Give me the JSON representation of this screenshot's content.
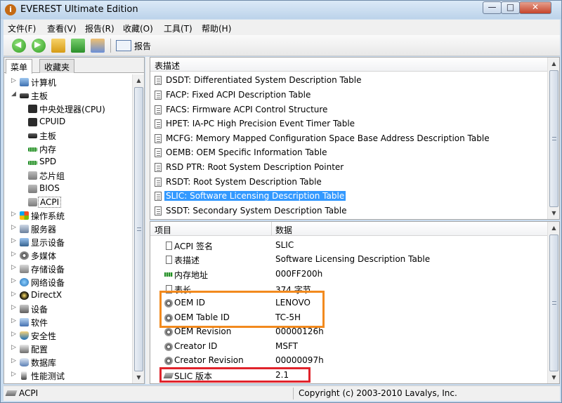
{
  "window": {
    "title": "EVEREST Ultimate Edition",
    "app_icon_glyph": "i"
  },
  "window_controls": {
    "minimize": "—",
    "maximize": "□",
    "close": "✕"
  },
  "menu": [
    "文件(F)",
    "查看(V)",
    "报告(R)",
    "收藏(O)",
    "工具(T)",
    "帮助(H)"
  ],
  "toolbar": {
    "report_label": "报告",
    "back_glyph": "◀",
    "forward_glyph": "▶"
  },
  "left_tabs": {
    "menu": "菜单",
    "favorites": "收藏夹"
  },
  "tree": [
    {
      "label": "计算机",
      "expander": "▷",
      "icon": "computer-icon"
    },
    {
      "label": "主板",
      "expander": "◢",
      "icon": "motherboard-icon"
    },
    {
      "label": "中央处理器(CPU)",
      "icon": "cpu-icon"
    },
    {
      "label": "CPUID",
      "icon": "cpuid-icon"
    },
    {
      "label": "主板",
      "icon": "motherboard-icon"
    },
    {
      "label": "内存",
      "icon": "memory-icon"
    },
    {
      "label": "SPD",
      "icon": "spd-icon"
    },
    {
      "label": "芯片组",
      "icon": "chipset-icon"
    },
    {
      "label": "BIOS",
      "icon": "bios-icon"
    },
    {
      "label": "ACPI",
      "icon": "acpi-icon",
      "selected": true
    },
    {
      "label": "操作系统",
      "expander": "▷",
      "icon": "windows-icon"
    },
    {
      "label": "服务器",
      "expander": "▷",
      "icon": "server-icon"
    },
    {
      "label": "显示设备",
      "expander": "▷",
      "icon": "monitor-icon"
    },
    {
      "label": "多媒体",
      "expander": "▷",
      "icon": "multimedia-icon"
    },
    {
      "label": "存储设备",
      "expander": "▷",
      "icon": "storage-icon"
    },
    {
      "label": "网络设备",
      "expander": "▷",
      "icon": "network-icon"
    },
    {
      "label": "DirectX",
      "expander": "▷",
      "icon": "directx-icon"
    },
    {
      "label": "设备",
      "expander": "▷",
      "icon": "devices-icon"
    },
    {
      "label": "软件",
      "expander": "▷",
      "icon": "software-icon"
    },
    {
      "label": "安全性",
      "expander": "▷",
      "icon": "security-icon"
    },
    {
      "label": "配置",
      "expander": "▷",
      "icon": "config-icon"
    },
    {
      "label": "数据库",
      "expander": "▷",
      "icon": "database-icon"
    },
    {
      "label": "性能测试",
      "expander": "▷",
      "icon": "benchmark-icon"
    }
  ],
  "tables_pane": {
    "header": "表描述",
    "rows": [
      "DSDT: Differentiated System Description Table",
      "FACP: Fixed ACPI Description Table",
      "FACS: Firmware ACPI Control Structure",
      "HPET: IA-PC High Precision Event Timer Table",
      "MCFG: Memory Mapped Configuration Space Base Address Description Table",
      "OEMB: OEM Specific Information Table",
      "RSD PTR: Root System Description Pointer",
      "RSDT: Root System Description Table",
      "SLIC: Software Licensing Description Table",
      "SSDT: Secondary System Description Table"
    ],
    "selected_index": 8
  },
  "details_pane": {
    "col_item": "项目",
    "col_value": "数据",
    "rows": [
      {
        "name": "ACPI 签名",
        "value": "SLIC",
        "icon": "document-icon"
      },
      {
        "name": "表描述",
        "value": "Software Licensing Description Table",
        "icon": "document-icon"
      },
      {
        "name": "内存地址",
        "value": "000FF200h",
        "icon": "memory-icon"
      },
      {
        "name": "表长",
        "value": "374 字节",
        "icon": "document-icon"
      },
      {
        "name": "OEM ID",
        "value": "LENOVO",
        "icon": "gear-icon"
      },
      {
        "name": "OEM Table ID",
        "value": "TC-5H",
        "icon": "gear-icon"
      },
      {
        "name": "OEM Revision",
        "value": "00000126h",
        "icon": "gear-icon"
      },
      {
        "name": "Creator ID",
        "value": "MSFT",
        "icon": "gear-icon"
      },
      {
        "name": "Creator Revision",
        "value": "00000097h",
        "icon": "gear-icon"
      },
      {
        "name": "SLIC 版本",
        "value": "2.1",
        "icon": "chip-icon"
      }
    ]
  },
  "scroll_glyphs": {
    "up": "▲",
    "down": "▼"
  },
  "status": {
    "left": "ACPI",
    "right": "Copyright (c) 2003-2010 Lavalys, Inc."
  },
  "colors": {
    "selection": "#3399ff",
    "highlight_orange": "#f28a1e",
    "highlight_red": "#e0232b"
  }
}
